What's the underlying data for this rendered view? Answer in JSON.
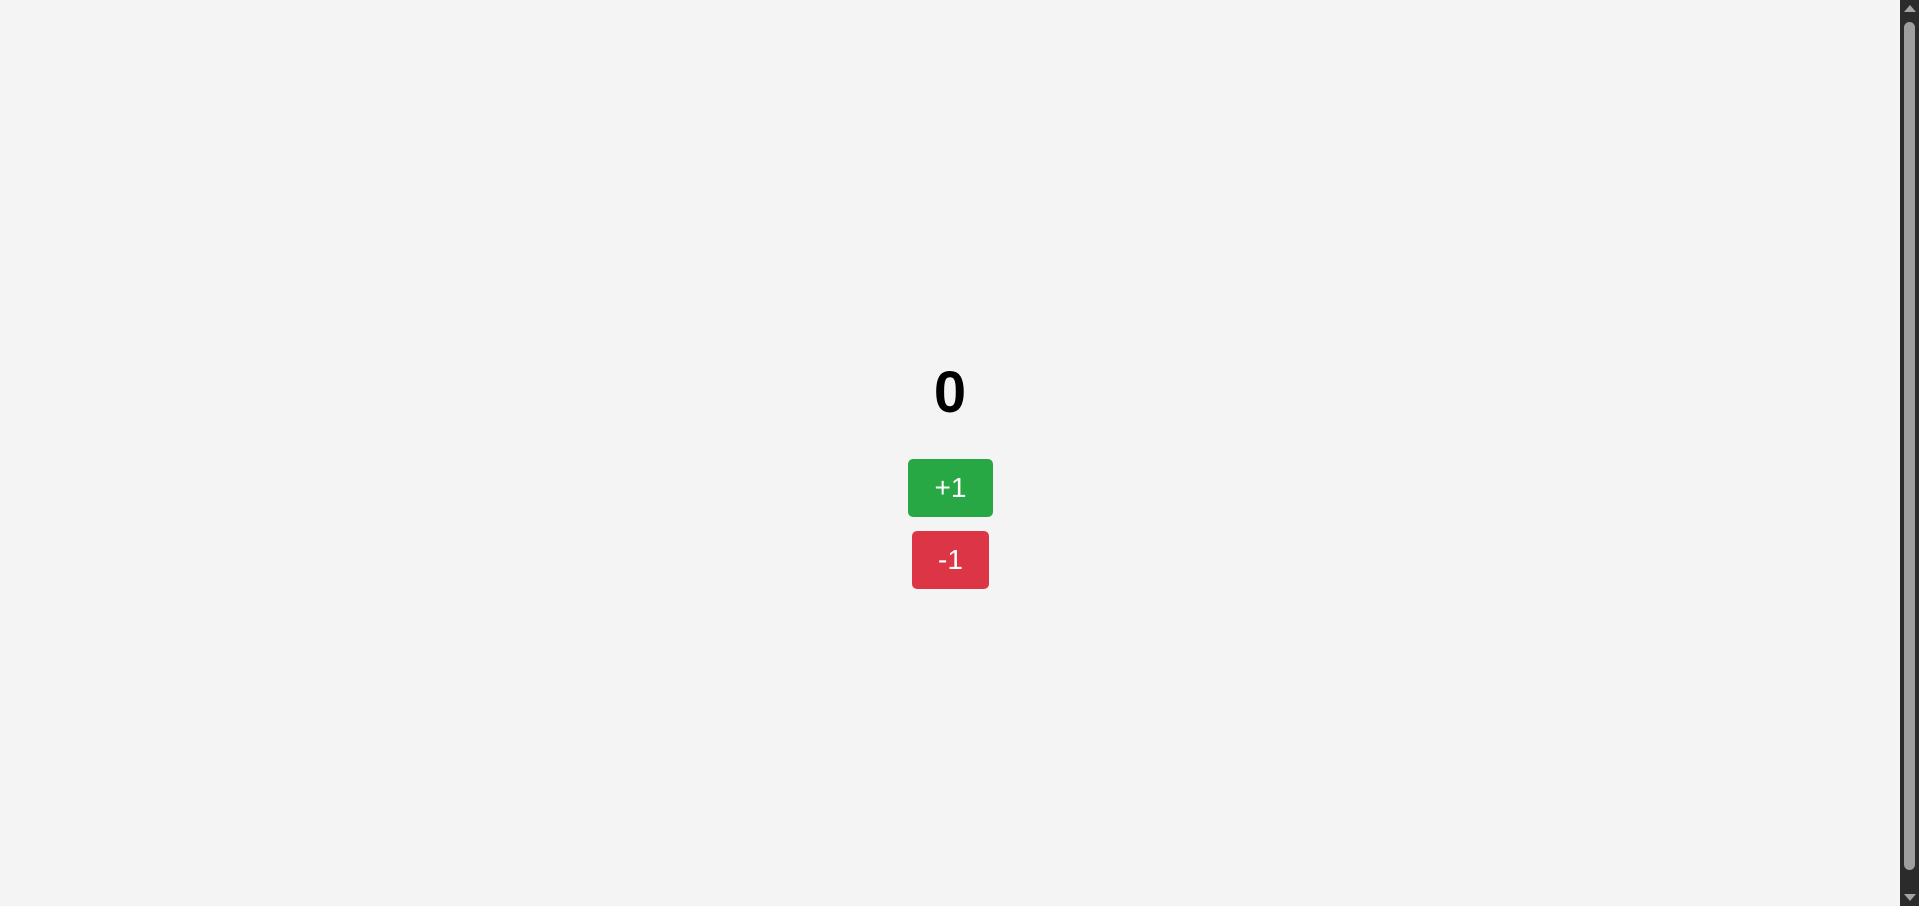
{
  "counter": {
    "value": "0"
  },
  "buttons": {
    "increment_label": "+1",
    "decrement_label": "-1"
  },
  "colors": {
    "background": "#f4f4f4",
    "increment": "#28a745",
    "decrement": "#dc3545",
    "text": "#000000",
    "button_text": "#ffffff"
  }
}
